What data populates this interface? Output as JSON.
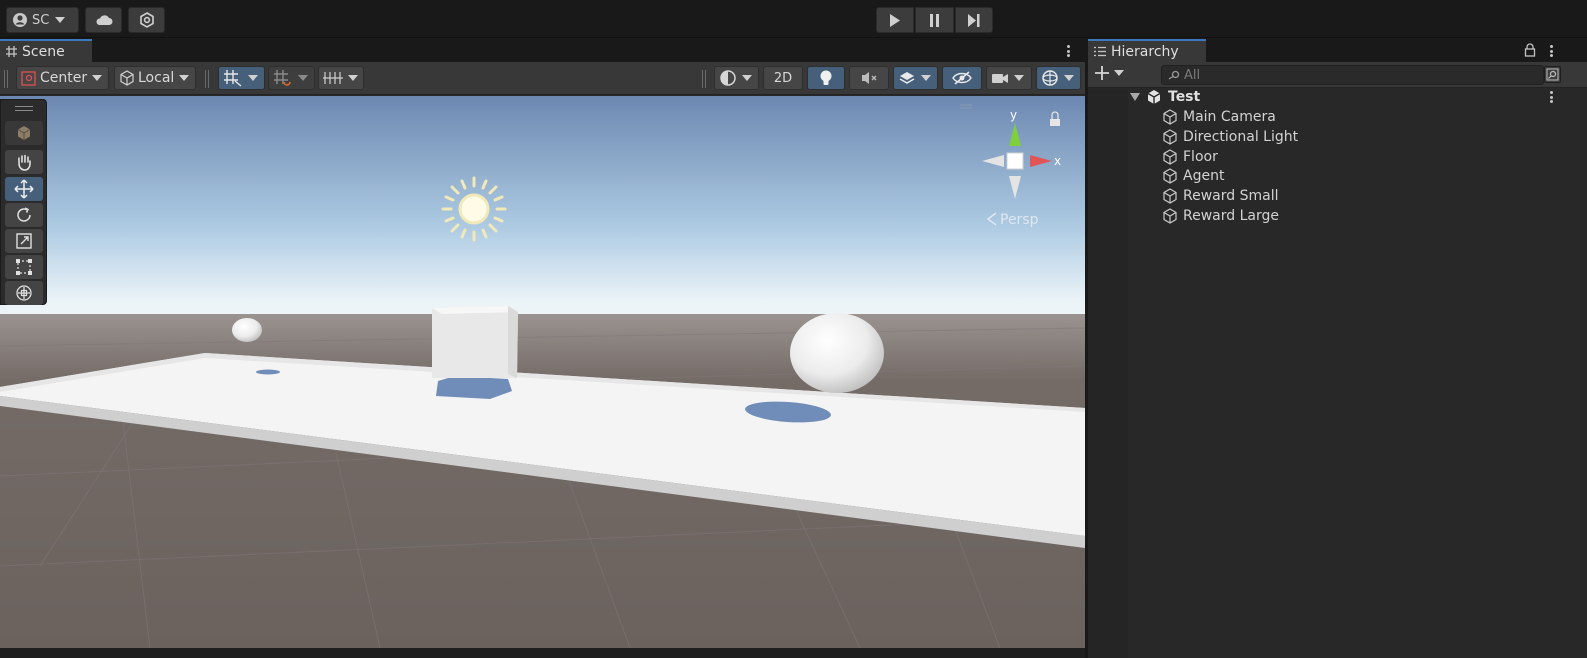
{
  "toolbar": {
    "account_label": "SC",
    "icons": [
      "account-icon",
      "cloud-icon",
      "collab-icon",
      "play-icon",
      "pause-icon",
      "step-icon"
    ]
  },
  "scene_panel": {
    "tab_label": "Scene",
    "pivot_mode": "Center",
    "pivot_rotation": "Local",
    "mode_2d": "2D",
    "camera_mode": "Persp",
    "gizmo_axes": {
      "y": "y",
      "x": "x"
    }
  },
  "hierarchy": {
    "tab_label": "Hierarchy",
    "search_placeholder": "All",
    "scene_name": "Test",
    "objects": [
      "Main Camera",
      "Directional Light",
      "Floor",
      "Agent",
      "Reward Small",
      "Reward Large"
    ]
  },
  "colors": {
    "accent_blue": "#46607c",
    "tab_highlight": "#3a79bb",
    "sky_top": "#6e8bb3",
    "horizon": "#e9f2f6",
    "ground": "#6b625e"
  }
}
